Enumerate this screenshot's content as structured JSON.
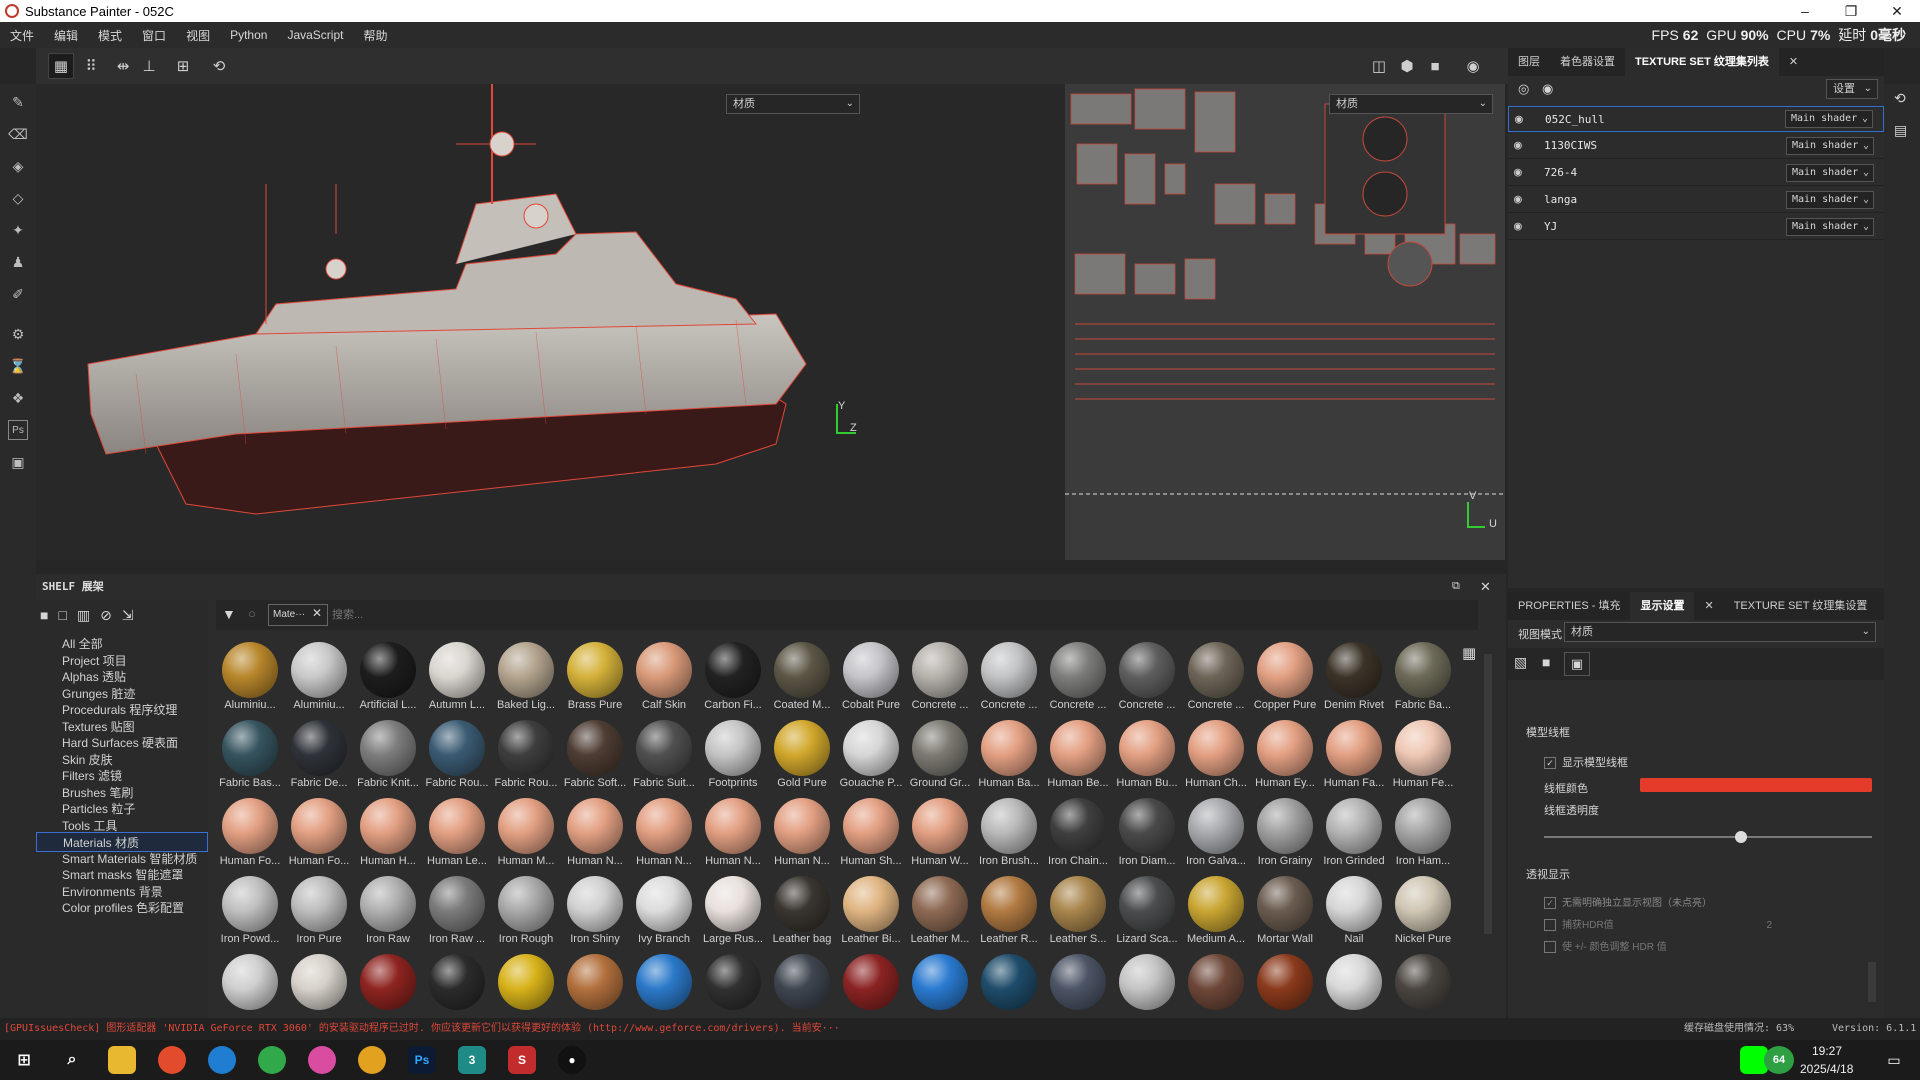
{
  "title": "Substance Painter - 052C",
  "window_controls": [
    "–",
    "❐",
    "✕"
  ],
  "menu": [
    "文件",
    "编辑",
    "模式",
    "窗口",
    "视图",
    "Python",
    "JavaScript",
    "帮助"
  ],
  "stats": {
    "fps_label": "FPS",
    "fps": "62",
    "gpu_label": "GPU",
    "gpu": "90%",
    "cpu_label": "CPU",
    "cpu": "7%",
    "latency_label": "延时",
    "latency": "0毫秒"
  },
  "viewport": {
    "material_dropdown_3d": "材质",
    "material_dropdown_2d": "材质",
    "axis_3d_y": "Y",
    "axis_3d_z": "Z",
    "axis_2d_v": "V",
    "axis_2d_u": "U"
  },
  "layers_panel": {
    "tabs": [
      "图层",
      "着色器设置",
      "TEXTURE SET 纹理集列表"
    ],
    "settings_label": "设置",
    "texture_sets": [
      {
        "name": "052C_hull",
        "shader": "Main shader"
      },
      {
        "name": "1130CIWS",
        "shader": "Main shader"
      },
      {
        "name": "726-4",
        "shader": "Main shader"
      },
      {
        "name": "langa",
        "shader": "Main shader"
      },
      {
        "name": "YJ",
        "shader": "Main shader"
      }
    ]
  },
  "shelf": {
    "title": "SHELF 展架",
    "filter_tag": "Mate···",
    "search_placeholder": "搜索...",
    "categories": [
      "All 全部",
      "Project 项目",
      "Alphas 透贴",
      "Grunges 脏迹",
      "Procedurals 程序纹理",
      "Textures 贴图",
      "Hard Surfaces 硬表面",
      "Skin 皮肤",
      "Filters 滤镜",
      "Brushes 笔刷",
      "Particles 粒子",
      "Tools 工具",
      "Materials 材质",
      "Smart Materials 智能材质",
      "Smart masks 智能遮罩",
      "Environments 背景",
      "Color profiles 色彩配置"
    ],
    "selected_category": "Materials 材质",
    "materials": [
      {
        "label": "Aluminiu...",
        "color": "#b8862b"
      },
      {
        "label": "Aluminiu...",
        "color": "#c9c9c9"
      },
      {
        "label": "Artificial L...",
        "color": "#1d1d1d"
      },
      {
        "label": "Autumn L...",
        "color": "#d9d5cf"
      },
      {
        "label": "Baked Lig...",
        "color": "#b3a48e"
      },
      {
        "label": "Brass Pure",
        "color": "#d4b13a"
      },
      {
        "label": "Calf Skin",
        "color": "#d99a79"
      },
      {
        "label": "Carbon Fi...",
        "color": "#222222"
      },
      {
        "label": "Coated M...",
        "color": "#5c5646"
      },
      {
        "label": "Cobalt Pure",
        "color": "#c4c4c9"
      },
      {
        "label": "Concrete ...",
        "color": "#b5b1ab"
      },
      {
        "label": "Concrete ...",
        "color": "#c2c3c5"
      },
      {
        "label": "Concrete ...",
        "color": "#7d7d7b"
      },
      {
        "label": "Concrete ...",
        "color": "#5e5e5e"
      },
      {
        "label": "Concrete ...",
        "color": "#6e6558"
      },
      {
        "label": "Copper Pure",
        "color": "#e2a083"
      },
      {
        "label": "Denim Rivet",
        "color": "#3b3328"
      },
      {
        "label": "Fabric Ba...",
        "color": "#6d6a58"
      },
      {
        "label": "Fabric Bas...",
        "color": "#36545f"
      },
      {
        "label": "Fabric De...",
        "color": "#2f3339"
      },
      {
        "label": "Fabric Knit...",
        "color": "#7d7d7d"
      },
      {
        "label": "Fabric Rou...",
        "color": "#3b5b73"
      },
      {
        "label": "Fabric Rou...",
        "color": "#3e3e3e"
      },
      {
        "label": "Fabric Soft...",
        "color": "#4e3d33"
      },
      {
        "label": "Fabric Suit...",
        "color": "#505050"
      },
      {
        "label": "Footprints",
        "color": "#c5c5c5"
      },
      {
        "label": "Gold Pure",
        "color": "#d1a72c"
      },
      {
        "label": "Gouache P...",
        "color": "#d6d6d6"
      },
      {
        "label": "Ground Gr...",
        "color": "#7c7a72"
      },
      {
        "label": "Human Ba...",
        "color": "#e3a083"
      },
      {
        "label": "Human Be...",
        "color": "#e3a083"
      },
      {
        "label": "Human Bu...",
        "color": "#e3a083"
      },
      {
        "label": "Human Ch...",
        "color": "#e3a083"
      },
      {
        "label": "Human Ey...",
        "color": "#e3a083"
      },
      {
        "label": "Human Fa...",
        "color": "#e3a083"
      },
      {
        "label": "Human Fe...",
        "color": "#efc7b4"
      },
      {
        "label": "Human Fo...",
        "color": "#e3a083"
      },
      {
        "label": "Human Fo...",
        "color": "#e3a083"
      },
      {
        "label": "Human H...",
        "color": "#e3a083"
      },
      {
        "label": "Human Le...",
        "color": "#e3a083"
      },
      {
        "label": "Human M...",
        "color": "#e3a083"
      },
      {
        "label": "Human N...",
        "color": "#e3a083"
      },
      {
        "label": "Human N...",
        "color": "#e3a083"
      },
      {
        "label": "Human N...",
        "color": "#e3a083"
      },
      {
        "label": "Human N...",
        "color": "#e3a083"
      },
      {
        "label": "Human Sh...",
        "color": "#e3a083"
      },
      {
        "label": "Human W...",
        "color": "#e3a083"
      },
      {
        "label": "Iron Brush...",
        "color": "#b9b9b9"
      },
      {
        "label": "Iron Chain...",
        "color": "#3f3f3f"
      },
      {
        "label": "Iron Diam...",
        "color": "#4a4a4a"
      },
      {
        "label": "Iron Galva...",
        "color": "#a8abae"
      },
      {
        "label": "Iron Grainy",
        "color": "#a0a0a0"
      },
      {
        "label": "Iron Grinded",
        "color": "#b4b4b4"
      },
      {
        "label": "Iron Ham...",
        "color": "#a6a6a6"
      },
      {
        "label": "Iron Powd...",
        "color": "#c0c0c0"
      },
      {
        "label": "Iron Pure",
        "color": "#bdbdbd"
      },
      {
        "label": "Iron Raw",
        "color": "#b0b0b0"
      },
      {
        "label": "Iron Raw ...",
        "color": "#7b7b7b"
      },
      {
        "label": "Iron Rough",
        "color": "#a9a9a9"
      },
      {
        "label": "Iron Shiny",
        "color": "#d0d0d0"
      },
      {
        "label": "Ivy Branch",
        "color": "#dcdcdc"
      },
      {
        "label": "Large Rus...",
        "color": "#e8e0dc"
      },
      {
        "label": "Leather bag",
        "color": "#3a3530"
      },
      {
        "label": "Leather Bi...",
        "color": "#e0b582"
      },
      {
        "label": "Leather M...",
        "color": "#8e6a54"
      },
      {
        "label": "Leather R...",
        "color": "#b17a42"
      },
      {
        "label": "Leather S...",
        "color": "#a8854c"
      },
      {
        "label": "Lizard Sca...",
        "color": "#4b4e4f"
      },
      {
        "label": "Medium A...",
        "color": "#c9a532"
      },
      {
        "label": "Mortar Wall",
        "color": "#6a5c4f"
      },
      {
        "label": "Nail",
        "color": "#d6d6d6"
      },
      {
        "label": "Nickel Pure",
        "color": "#cfc6b3"
      },
      {
        "label": "",
        "color": "#cfcfcf"
      },
      {
        "label": "",
        "color": "#d6d1c9"
      },
      {
        "label": "",
        "color": "#8e2420"
      },
      {
        "label": "",
        "color": "#2b2b2b"
      },
      {
        "label": "",
        "color": "#d7b21a"
      },
      {
        "label": "",
        "color": "#b2703d"
      },
      {
        "label": "",
        "color": "#2b79c9"
      },
      {
        "label": "",
        "color": "#303030"
      },
      {
        "label": "",
        "color": "#3f4650"
      },
      {
        "label": "",
        "color": "#8b2323"
      },
      {
        "label": "",
        "color": "#2a7ad0"
      },
      {
        "label": "",
        "color": "#1e4c6a"
      },
      {
        "label": "",
        "color": "#4c5566"
      },
      {
        "label": "",
        "color": "#c4c4c4"
      },
      {
        "label": "",
        "color": "#6d4738"
      },
      {
        "label": "",
        "color": "#8a3a1c"
      },
      {
        "label": "",
        "color": "#d8d8d8"
      },
      {
        "label": "",
        "color": "#4a4540"
      }
    ]
  },
  "properties": {
    "tabs": [
      "PROPERTIES - 填充",
      "显示设置",
      "TEXTURE SET 纹理集设置"
    ],
    "view_mode_label": "视图模式",
    "view_mode_value": "材质",
    "section_wireframe": "模型线框",
    "show_wireframe": "显示模型线框",
    "wireframe_color": "线框颜色",
    "wireframe_color_value": "#e53b2a",
    "wireframe_opacity": "线框透明度",
    "wireframe_opacity_value": 0.6,
    "section_transparency": "透视显示",
    "transparency_opt1": "无需明确独立显示视图（未点亮）",
    "transparency_opt2": "捕获HDR值",
    "transparency_opt2_value": "2",
    "transparency_opt3": "使 +/- 颜色调整 HDR 值"
  },
  "status": {
    "message": "[GPUIssuesCheck] 图形适配器 'NVIDIA GeForce RTX 3060' 的安装驱动程序已过时. 你应该更新它们以获得更好的体验 (http://www.geforce.com/drivers). 当前安···",
    "cache": "缓存磁盘使用情况: 63%",
    "version": "Version: 6.1.1"
  },
  "taskbar": {
    "time": "19:27",
    "date": "2025/4/18",
    "badge": "64"
  }
}
